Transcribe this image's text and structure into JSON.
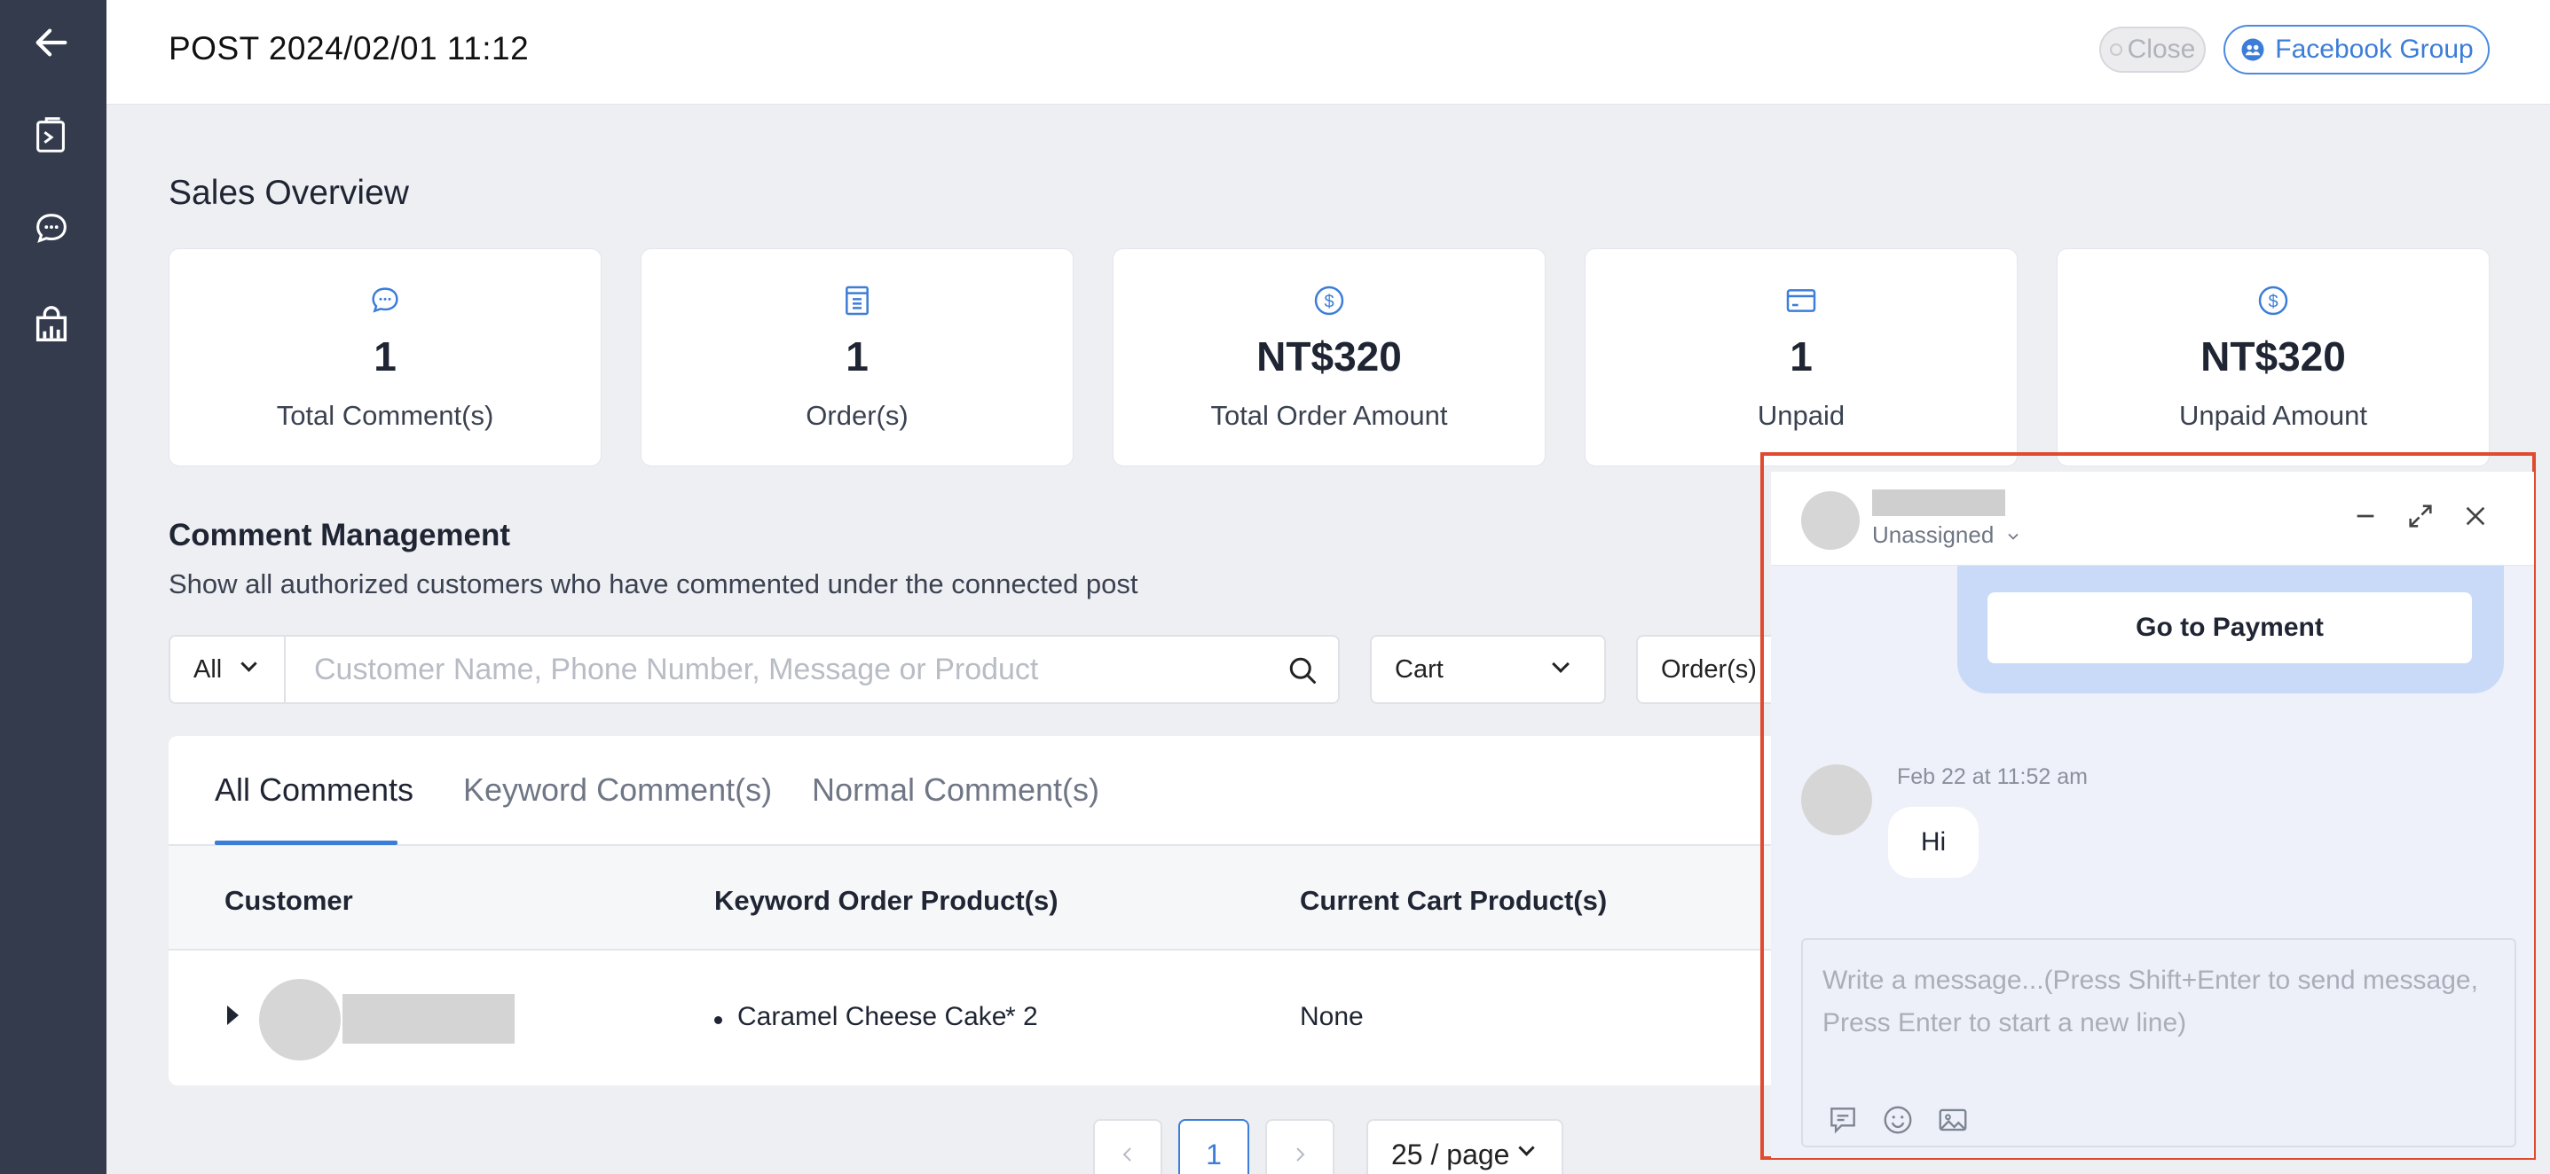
{
  "header": {
    "title": "POST 2024/02/01 11:12",
    "close_label": "Close",
    "facebook_label": "Facebook Group"
  },
  "sidebar": {
    "items": [
      {
        "icon": "back-arrow-icon"
      },
      {
        "icon": "post-list-icon"
      },
      {
        "icon": "chat-bubble-icon"
      },
      {
        "icon": "shopping-bag-chart-icon"
      }
    ]
  },
  "overview": {
    "title": "Sales Overview",
    "cards": [
      {
        "icon": "comment-icon",
        "value": "1",
        "label": "Total Comment(s)"
      },
      {
        "icon": "receipt-icon",
        "value": "1",
        "label": "Order(s)"
      },
      {
        "icon": "dollar-icon",
        "value": "NT$320",
        "label": "Total Order Amount"
      },
      {
        "icon": "card-icon",
        "value": "1",
        "label": "Unpaid"
      },
      {
        "icon": "dollar-icon",
        "value": "NT$320",
        "label": "Unpaid Amount"
      }
    ]
  },
  "comments": {
    "title": "Comment Management",
    "subtitle": "Show all authorized customers who have commented under the connected post",
    "filter_all": "All",
    "search_placeholder": "Customer Name, Phone Number, Message or Product",
    "filter_cart": "Cart",
    "filter_order": "Order(s)",
    "tabs": [
      "All Comments",
      "Keyword Comment(s)",
      "Normal Comment(s)"
    ],
    "columns": [
      "Customer",
      "Keyword Order Product(s)",
      "Current Cart Product(s)"
    ],
    "rows": [
      {
        "product": "Caramel Cheese Cake",
        "qty": "* 2",
        "cart": "None"
      }
    ]
  },
  "pagination": {
    "current": "1",
    "page_size": "25 / page"
  },
  "chat": {
    "assignee": "Unassigned",
    "pay_button": "Go to Payment",
    "message_time": "Feb 22 at 11:52 am",
    "message_text": "Hi",
    "composer_placeholder": "Write a message...(Press Shift+Enter to send message, Press Enter to start a new line)"
  },
  "colors": {
    "sidebar": "#333b4d",
    "accent": "#3c7dd8",
    "highlight_border": "#e04a2f"
  }
}
